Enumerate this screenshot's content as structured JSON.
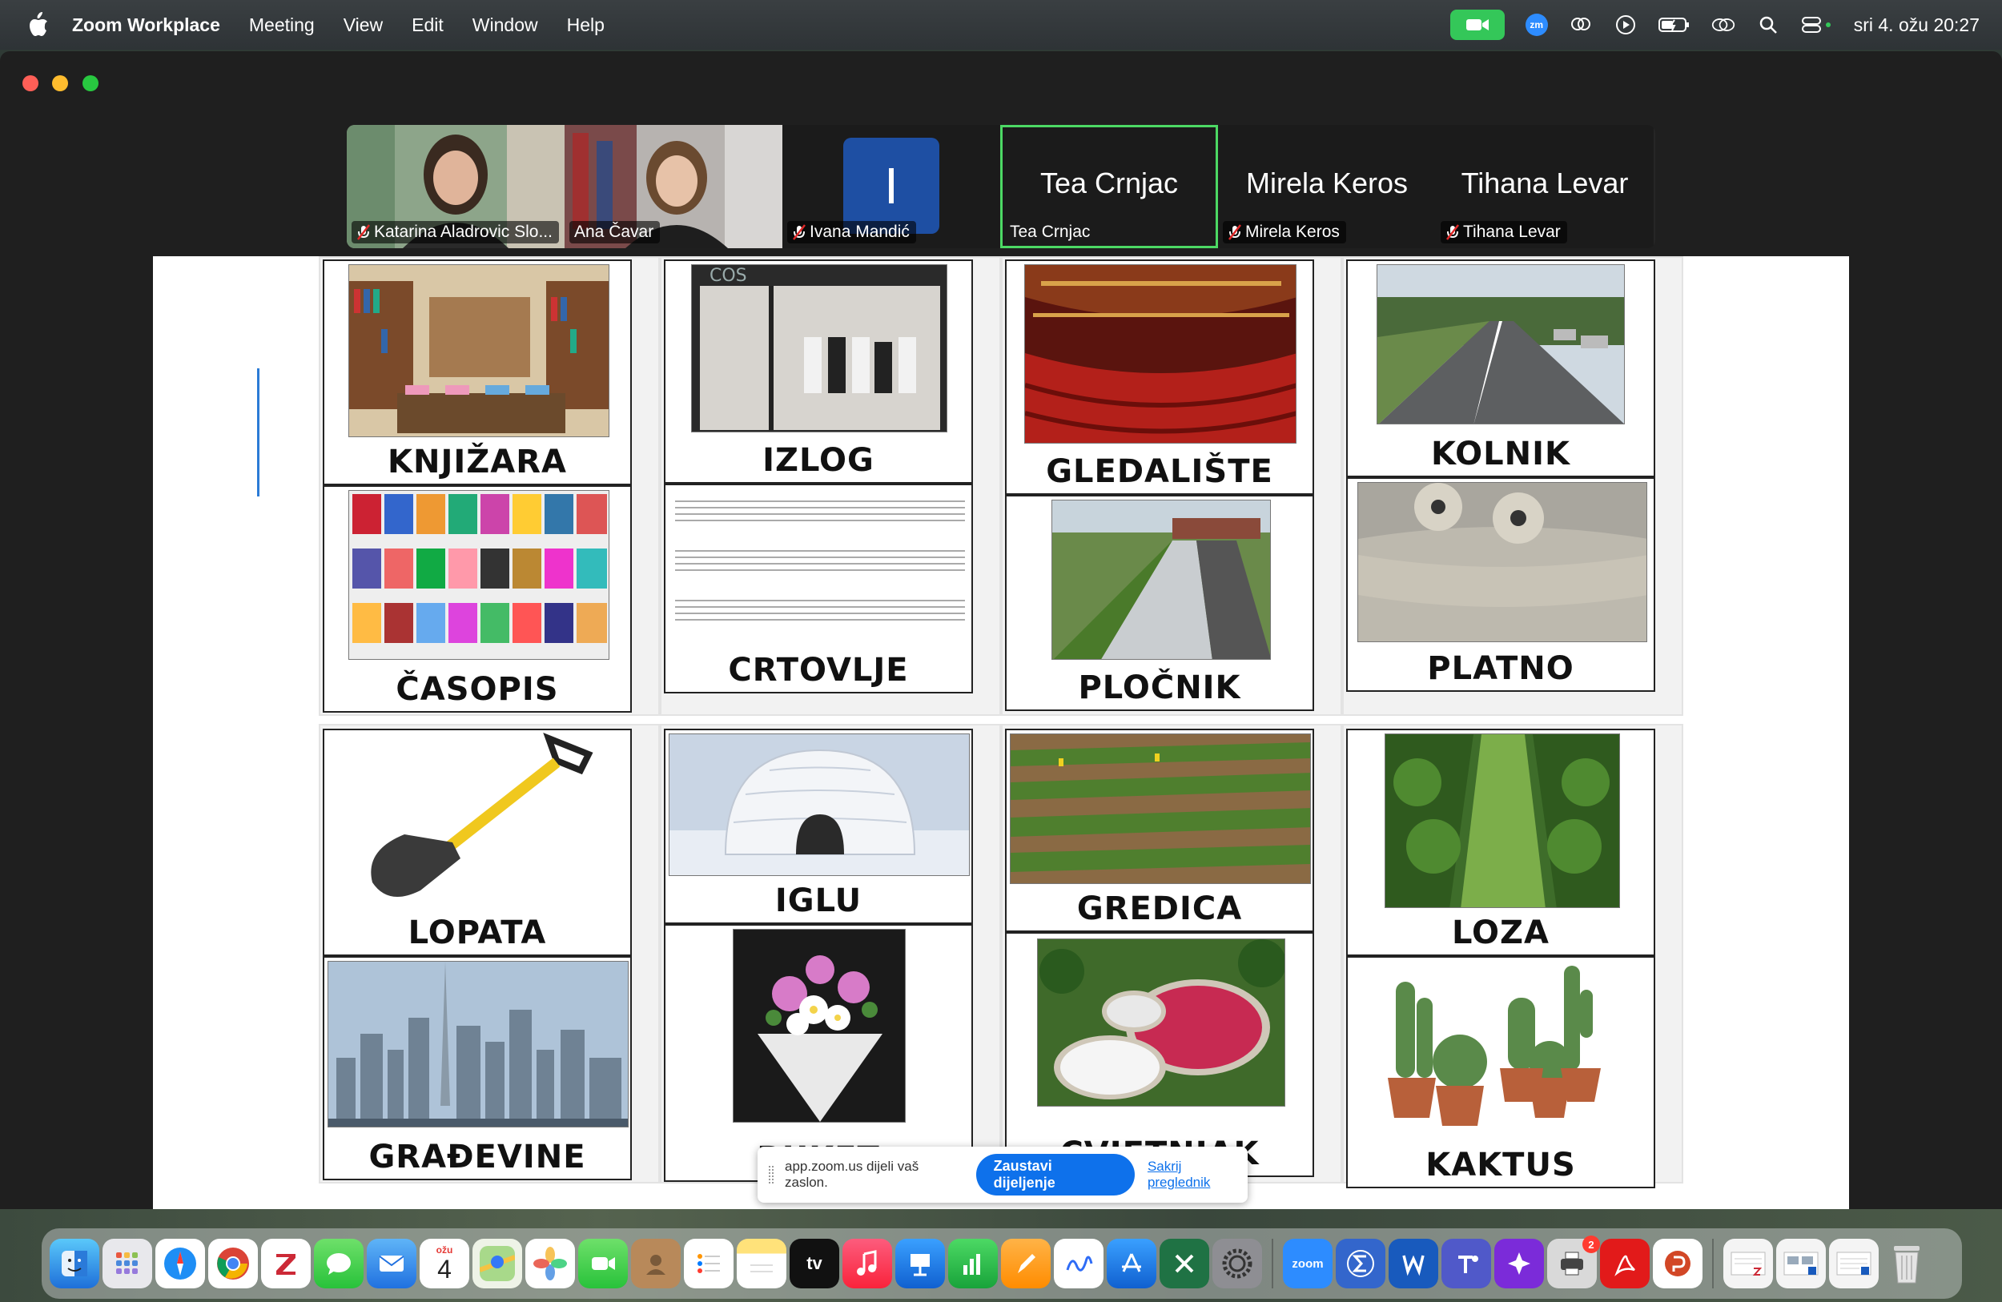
{
  "menubar": {
    "app_name": "Zoom Workplace",
    "menus": [
      "Meeting",
      "View",
      "Edit",
      "Window",
      "Help"
    ],
    "zoom_badge": "zm",
    "clock": "sri 4. ožu 20:27"
  },
  "participants": [
    {
      "name": "Katarina Aladrovic Slo...",
      "muted": true,
      "type": "video"
    },
    {
      "name": "Ana Čavar",
      "muted": false,
      "type": "video"
    },
    {
      "name": "Ivana Mandić",
      "muted": true,
      "type": "avatar",
      "initial": "I"
    },
    {
      "name": "Tea Crnjac",
      "muted": false,
      "type": "name",
      "big_name": "Tea Crnjac",
      "active": true
    },
    {
      "name": "Mirela Keros",
      "muted": true,
      "type": "name",
      "big_name": "Mirela Keros"
    },
    {
      "name": "Tihana Levar",
      "muted": true,
      "type": "name",
      "big_name": "Tihana Levar"
    }
  ],
  "cards": {
    "knjizara": "KNJIŽARA",
    "casopis": "ČASOPIS",
    "izlog": "IZLOG",
    "crtovlje": "CRTOVLJE",
    "gledaliste": "GLEDALIŠTE",
    "plocnik": "PLOČNIK",
    "kolnik": "KOLNIK",
    "platno": "PLATNO",
    "lopata": "LOPATA",
    "gradevine": "GRAĐEVINE",
    "iglu": "IGLU",
    "buket": "BUKET",
    "gredica": "GREDICA",
    "cvjetnjak": "CVJETNJAK",
    "loza": "LOZA",
    "kaktus": "KAKTUS",
    "cos_sign": "COS"
  },
  "share_bar": {
    "message": "app.zoom.us dijeli vaš zaslon.",
    "stop_label": "Zaustavi dijeljenje",
    "hide_label": "Sakrij preglednik"
  },
  "dock": {
    "calendar_month": "ožu",
    "calendar_day": "4",
    "tv_label": "tv",
    "zoom_label": "zoom",
    "printer_badge": "2"
  },
  "colors": {
    "video_on": "#34c759",
    "active_speaker": "#4cd964",
    "zoom_blue": "#0e71eb"
  }
}
